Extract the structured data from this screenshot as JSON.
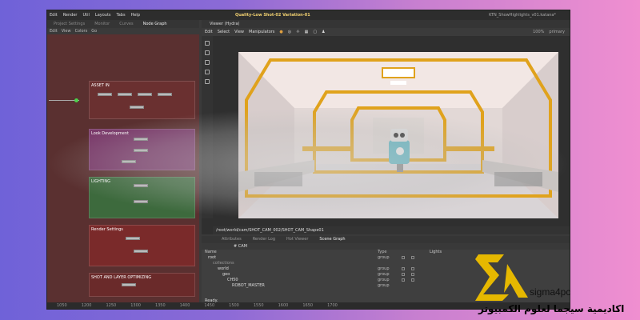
{
  "menubar": {
    "items": [
      "Edit",
      "Render",
      "Util",
      "Layouts",
      "Tabs",
      "Help"
    ],
    "title_prefix": "Quality-Low Shot-02 Variation-01",
    "file": "KTN_ShowHighlights_v01.katana*"
  },
  "left_panel": {
    "tabs": [
      "Project Settings",
      "Monitor",
      "Curves",
      "Node Graph"
    ],
    "active_tab": "Node Graph",
    "submenu": [
      "Edit",
      "View",
      "Colors",
      "Go"
    ],
    "backdrops": [
      {
        "title": "ASSET IN"
      },
      {
        "title": "Look Development"
      },
      {
        "title": "LIGHTING"
      },
      {
        "title": "Render Settings"
      },
      {
        "title": "SHOT AND LAYER OPTIMIZING"
      }
    ]
  },
  "viewer": {
    "tab": "Viewer (Hydra)",
    "toolbar": [
      "Edit",
      "Select",
      "View",
      "Manipulators"
    ],
    "zoom": "100%",
    "camera": "primary",
    "path": "/root/world/cam/SHOT_CAM_002/SHOT_CAM_Shape01"
  },
  "scene": {
    "tabs": [
      "Attributes",
      "Render Log",
      "Hot Viewer",
      "Scene Graph"
    ],
    "active_tab": "Scene Graph",
    "bar_label": "# CAM",
    "headers": {
      "name": "Name",
      "type": "Type",
      "lights": "Lights"
    },
    "rows": [
      {
        "name": "root",
        "type": "group",
        "indent": 0
      },
      {
        "name": "collections",
        "type": "",
        "indent": 1
      },
      {
        "name": "world",
        "type": "group",
        "indent": 1
      },
      {
        "name": "geo",
        "type": "group",
        "indent": 2
      },
      {
        "name": "CH50",
        "type": "group",
        "indent": 3
      },
      {
        "name": "ROBOT_MASTER",
        "type": "group",
        "indent": 4
      }
    ],
    "status": "Ready."
  },
  "timeline": {
    "ticks": [
      "1050",
      "1200",
      "1250",
      "1300",
      "1350",
      "1400",
      "1450",
      "1500",
      "1550",
      "1600",
      "1650",
      "1700"
    ]
  },
  "watermark": {
    "brand": "sigma4pc",
    "arabic": "اكاديمية سيجما لعلوم الكمبيوتر",
    "logo_color": "#e6b800"
  }
}
